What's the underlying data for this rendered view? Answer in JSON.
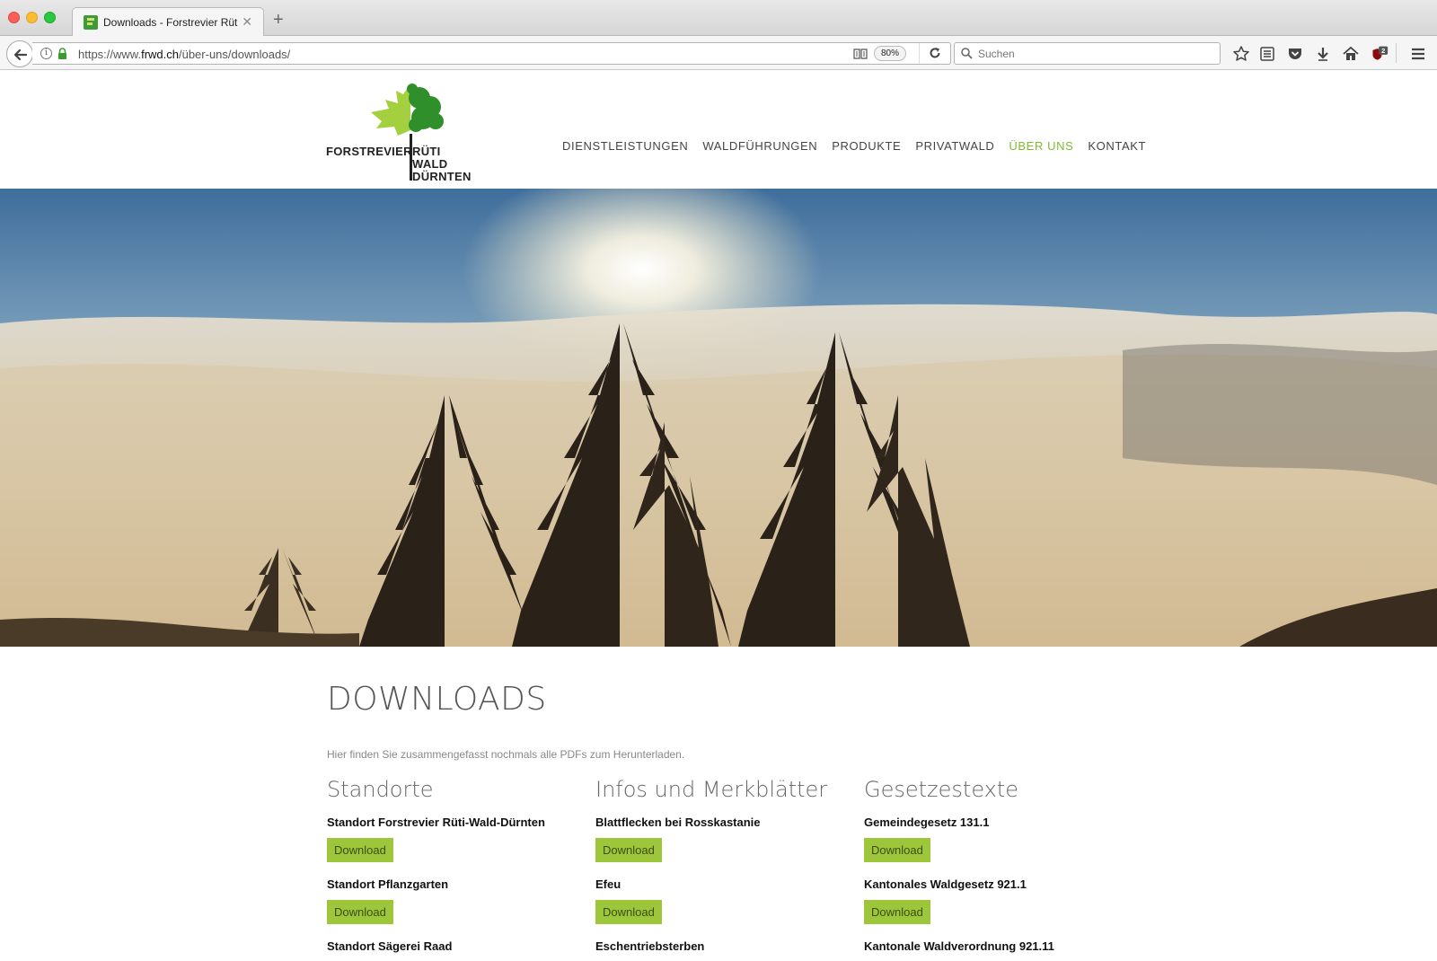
{
  "browser": {
    "tab": {
      "title": "Downloads - Forstrevier Rüti-Wald-Dürnten",
      "close": "✕"
    },
    "new_tab": "+",
    "url": {
      "prefix": "https://www.",
      "host": "frwd.ch",
      "path": "/über-uns/downloads/"
    },
    "zoom": "80%",
    "search_placeholder": "Suchen",
    "ublock_badge": "2"
  },
  "site": {
    "logo": {
      "line1": "FORSTREVIER",
      "line2": "RÜTI",
      "line3": "WALD",
      "line4": "DÜRNTEN"
    },
    "nav": [
      {
        "label": "DIENSTLEISTUNGEN",
        "active": false
      },
      {
        "label": "WALDFÜHRUNGEN",
        "active": false
      },
      {
        "label": "PRODUKTE",
        "active": false
      },
      {
        "label": "PRIVATWALD",
        "active": false
      },
      {
        "label": "ÜBER UNS",
        "active": true
      },
      {
        "label": "KONTAKT",
        "active": false
      }
    ],
    "accent_color": "#7dbb2c",
    "button_color": "#9dc63b"
  },
  "content": {
    "title": "DOWNLOADS",
    "intro": "Hier finden Sie zusammengefasst nochmals alle PDFs zum Herunterladen.",
    "columns": [
      {
        "heading": "Standorte",
        "items": [
          {
            "title": "Standort Forstrevier Rüti-Wald-Dürnten",
            "button": "Download"
          },
          {
            "title": "Standort Pflanzgarten",
            "button": "Download"
          },
          {
            "title": "Standort Sägerei Raad",
            "button": ""
          }
        ]
      },
      {
        "heading": "Infos und Merkblätter",
        "items": [
          {
            "title": "Blattflecken bei Rosskastanie",
            "button": "Download"
          },
          {
            "title": "Efeu",
            "button": "Download"
          },
          {
            "title": "Eschentriebsterben",
            "button": ""
          }
        ]
      },
      {
        "heading": "Gesetzestexte",
        "items": [
          {
            "title": "Gemeindegesetz 131.1",
            "button": "Download"
          },
          {
            "title": "Kantonales Waldgesetz 921.1",
            "button": "Download"
          },
          {
            "title": "Kantonale Waldverordnung 921.11",
            "button": ""
          }
        ]
      }
    ]
  }
}
